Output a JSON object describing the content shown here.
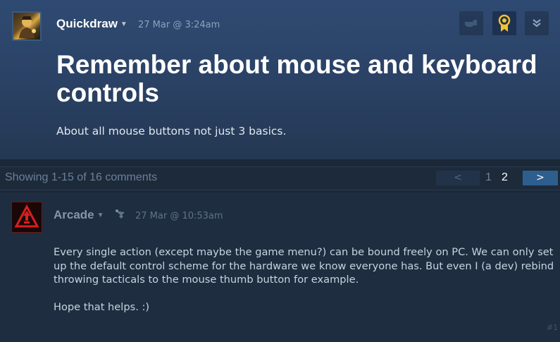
{
  "topic": {
    "author": "Quickdraw",
    "timestamp": "27 Mar @ 3:24am",
    "title": "Remember about mouse and keyboard controls",
    "subtitle": "About all mouse buttons not just 3 basics.",
    "icons": [
      "rate-up-icon",
      "award-icon",
      "more-options-icon"
    ],
    "award_color": "#f2c230"
  },
  "pagination": {
    "summary": "Showing 1-15 of 16 comments",
    "prev_label": "<",
    "pages": [
      "1",
      "2"
    ],
    "current_page": "2",
    "next_label": ">"
  },
  "comment": {
    "author": "Arcade",
    "timestamp": "27 Mar @ 10:53am",
    "paragraphs": [
      "Every single action (except maybe the game menu?) can be bound freely on PC. We can only set up the default control scheme for the hardware we know everyone has. But even I (a dev) rebind throwing tacticals to the mouse thumb button for example.",
      "Hope that helps. :)"
    ],
    "index": "#1",
    "dev_badge_icon": "developer-badge-icon",
    "avatar_accent": "#d81f1f"
  }
}
